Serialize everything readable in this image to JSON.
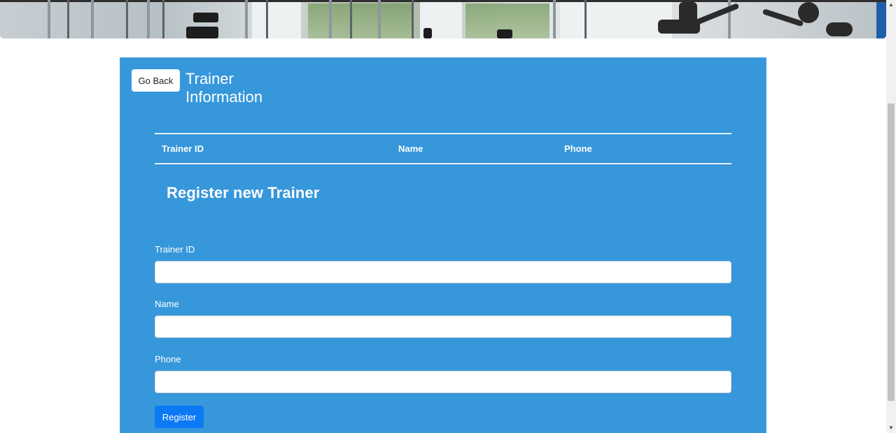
{
  "header": {
    "banner_image": "gym-equipment-photo"
  },
  "trainer_info": {
    "back_label": "Go Back",
    "title": "Trainer Information",
    "table": {
      "columns": [
        "Trainer ID",
        "Name",
        "Phone"
      ],
      "rows": []
    }
  },
  "register": {
    "title": "Register new Trainer",
    "fields": [
      {
        "label": "Trainer ID",
        "value": "",
        "placeholder": ""
      },
      {
        "label": "Name",
        "value": "",
        "placeholder": ""
      },
      {
        "label": "Phone",
        "value": "",
        "placeholder": ""
      }
    ],
    "submit_label": "Register"
  },
  "scrollbar": {
    "up_icon": "triangle-up-icon",
    "down_icon": "triangle-down-icon"
  },
  "colors": {
    "card_background": "#3697db",
    "primary_button": "#0b79f5",
    "text_on_card": "#ffffff"
  }
}
